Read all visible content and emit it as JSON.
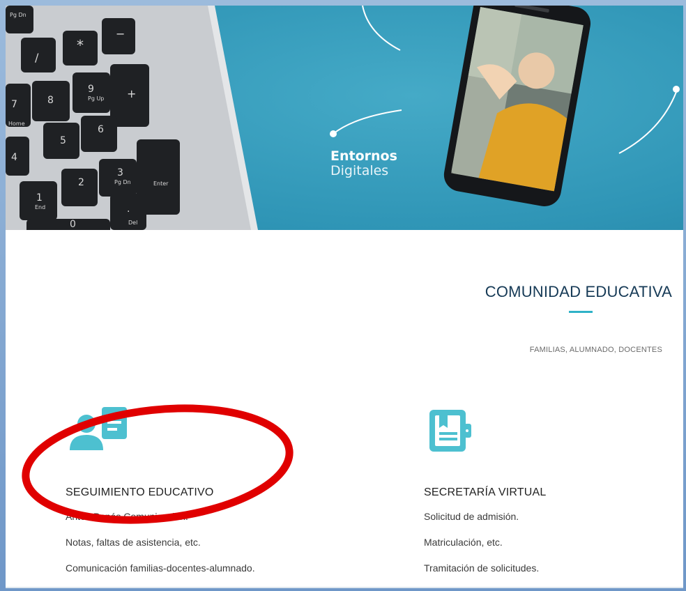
{
  "hero": {
    "title_bold": "Entornos",
    "title_regular": "Digitales",
    "keypad_keys": [
      "Pg Dn",
      "/",
      "*",
      "−",
      "7",
      "Home",
      "8",
      "9",
      "Pg Up",
      "+",
      "4",
      "5",
      "6",
      "1",
      "End",
      "2",
      "3",
      "Pg Dn",
      "Enter",
      "0",
      ".",
      "Del"
    ]
  },
  "section": {
    "title": "COMUNIDAD EDUCATIVA",
    "subtitle": "FAMILIAS, ALUMNADO, DOCENTES"
  },
  "features": [
    {
      "icon": "person-document-icon",
      "title": "SEGUIMIENTO EDUCATIVO",
      "items": [
        "Antes Papás Comunicación.",
        "Notas, faltas de asistencia, etc.",
        "Comunicación familias-docentes-alumnado."
      ]
    },
    {
      "icon": "tablet-document-icon",
      "title": "SECRETARÍA VIRTUAL",
      "items": [
        "Solicitud de admisión.",
        "Matriculación, etc.",
        "Tramitación de solicitudes."
      ]
    }
  ],
  "colors": {
    "hero_bg": "#2f95b6",
    "accent_teal": "#4dc0d0",
    "heading_navy": "#163a56",
    "annotation_red": "#e00000"
  }
}
